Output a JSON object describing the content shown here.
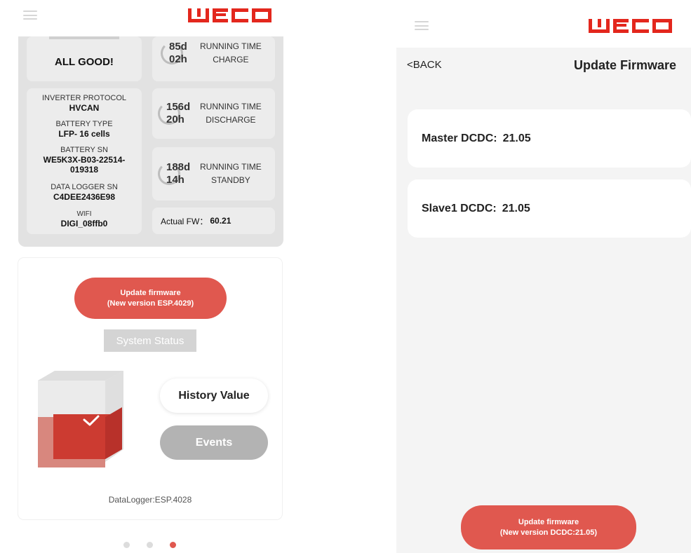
{
  "colors": {
    "brand_red": "#e3271d",
    "button_red": "#e0584f",
    "card_gray": "#ececec",
    "panel_gray": "#e2e2e2"
  },
  "left_screen": {
    "menu_icon": "hamburger-menu-icon",
    "logo_text": "WECO",
    "status": {
      "label": "ALL GOOD!"
    },
    "info": [
      {
        "label": "INVERTER PROTOCOL",
        "value": "HVCAN"
      },
      {
        "label": "BATTERY TYPE",
        "value": "LFP- 16 cells"
      },
      {
        "label": "BATTERY SN",
        "value": "WE5K3X-B03-22514-\n019318"
      },
      {
        "label": "DATA LOGGER SN",
        "value": "C4DEE2436E98"
      },
      {
        "label": "WIFI",
        "value": "DIGI_08ffb0"
      }
    ],
    "timers": [
      {
        "days": "85d",
        "hours": "02h",
        "line1": "RUNNING TIME",
        "line2": "CHARGE"
      },
      {
        "days": "156d",
        "hours": "20h",
        "line1": "RUNNING TIME",
        "line2": "DISCHARGE"
      },
      {
        "days": "188d",
        "hours": "14h",
        "line1": "RUNNING TIME",
        "line2": "STANDBY"
      }
    ],
    "actual_fw": {
      "label": "Actual FW：",
      "value": "60.21"
    },
    "update_button": {
      "line1": "Update firmware",
      "line2": "(New version ESP.4029)"
    },
    "system_status_label": "System Status",
    "history_button": "History Value",
    "events_button": "Events",
    "datalogger": "DataLogger:ESP.4028",
    "battery_icon": "battery-ok-icon",
    "page_dots": 3,
    "active_dot": 2
  },
  "right_screen": {
    "menu_icon": "hamburger-menu-icon",
    "logo_text": "WECO",
    "back_label": "<BACK",
    "title": "Update Firmware",
    "items": [
      {
        "label": "Master DCDC:",
        "value": "21.05"
      },
      {
        "label": "Slave1 DCDC:",
        "value": "21.05"
      }
    ],
    "update_button": {
      "line1": "Update firmware",
      "line2": "(New version DCDC:21.05)"
    }
  }
}
